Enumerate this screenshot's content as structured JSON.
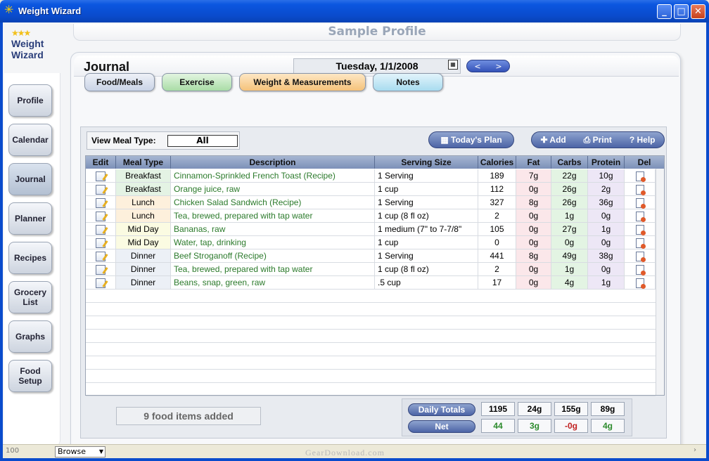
{
  "window": {
    "title": "Weight Wizard"
  },
  "profile_name": "Sample Profile",
  "logo": {
    "line1": "Weight",
    "line2": "Wizard"
  },
  "nav": [
    {
      "label": "Profile"
    },
    {
      "label": "Calendar"
    },
    {
      "label": "Journal"
    },
    {
      "label": "Planner"
    },
    {
      "label": "Recipes"
    },
    {
      "label": "Grocery\nList"
    },
    {
      "label": "Graphs"
    },
    {
      "label": "Food\nSetup"
    }
  ],
  "journal": {
    "title": "Journal",
    "date": "Tuesday, 1/1/2008",
    "prev": "<",
    "next": ">"
  },
  "tabs": [
    {
      "label": "Food/Meals",
      "color": "#c9d3e6"
    },
    {
      "label": "Exercise",
      "color": "#a9dca6"
    },
    {
      "label": "Weight & Measurements",
      "color": "#f5c27a"
    },
    {
      "label": "Notes",
      "color": "#a8dcef"
    }
  ],
  "meal_filter": {
    "label": "View Meal Type:",
    "value": "All"
  },
  "actions": {
    "todays_plan": "Today's Plan",
    "add": "Add",
    "print": "Print",
    "help": "Help"
  },
  "columns": [
    "Edit",
    "Meal Type",
    "Description",
    "Serving Size",
    "Calories",
    "Fat",
    "Carbs",
    "Protein",
    "Del"
  ],
  "rows": [
    {
      "meal": "Breakfast",
      "desc": "Cinnamon-Sprinkled French Toast (Recipe)",
      "serving": "1 Serving",
      "cal": "189",
      "fat": "7g",
      "carbs": "22g",
      "protein": "10g"
    },
    {
      "meal": "Breakfast",
      "desc": "Orange juice, raw",
      "serving": "1 cup",
      "cal": "112",
      "fat": "0g",
      "carbs": "26g",
      "protein": "2g"
    },
    {
      "meal": "Lunch",
      "desc": "Chicken Salad Sandwich (Recipe)",
      "serving": "1 Serving",
      "cal": "327",
      "fat": "8g",
      "carbs": "26g",
      "protein": "36g"
    },
    {
      "meal": "Lunch",
      "desc": "Tea, brewed, prepared with tap water",
      "serving": "1 cup (8 fl oz)",
      "cal": "2",
      "fat": "0g",
      "carbs": "1g",
      "protein": "0g"
    },
    {
      "meal": "Mid Day",
      "desc": "Bananas, raw",
      "serving": "1 medium (7\" to 7-7/8\"",
      "cal": "105",
      "fat": "0g",
      "carbs": "27g",
      "protein": "1g"
    },
    {
      "meal": "Mid Day",
      "desc": "Water, tap, drinking",
      "serving": "1 cup",
      "cal": "0",
      "fat": "0g",
      "carbs": "0g",
      "protein": "0g"
    },
    {
      "meal": "Dinner",
      "desc": "Beef Stroganoff (Recipe)",
      "serving": "1 Serving",
      "cal": "441",
      "fat": "8g",
      "carbs": "49g",
      "protein": "38g"
    },
    {
      "meal": "Dinner",
      "desc": "Tea, brewed, prepared with tap water",
      "serving": "1 cup (8 fl oz)",
      "cal": "2",
      "fat": "0g",
      "carbs": "1g",
      "protein": "0g"
    },
    {
      "meal": "Dinner",
      "desc": "Beans, snap, green, raw",
      "serving": ".5 cup",
      "cal": "17",
      "fat": "0g",
      "carbs": "4g",
      "protein": "1g"
    }
  ],
  "items_count": "9 food items added",
  "totals": {
    "daily_label": "Daily Totals",
    "net_label": "Net",
    "daily": [
      "1195",
      "24g",
      "155g",
      "89g"
    ],
    "net": [
      "44",
      "3g",
      "-0g",
      "4g"
    ]
  },
  "status": {
    "zoom": "100",
    "mode": "Browse",
    "watermark": "GearDownload.com"
  }
}
